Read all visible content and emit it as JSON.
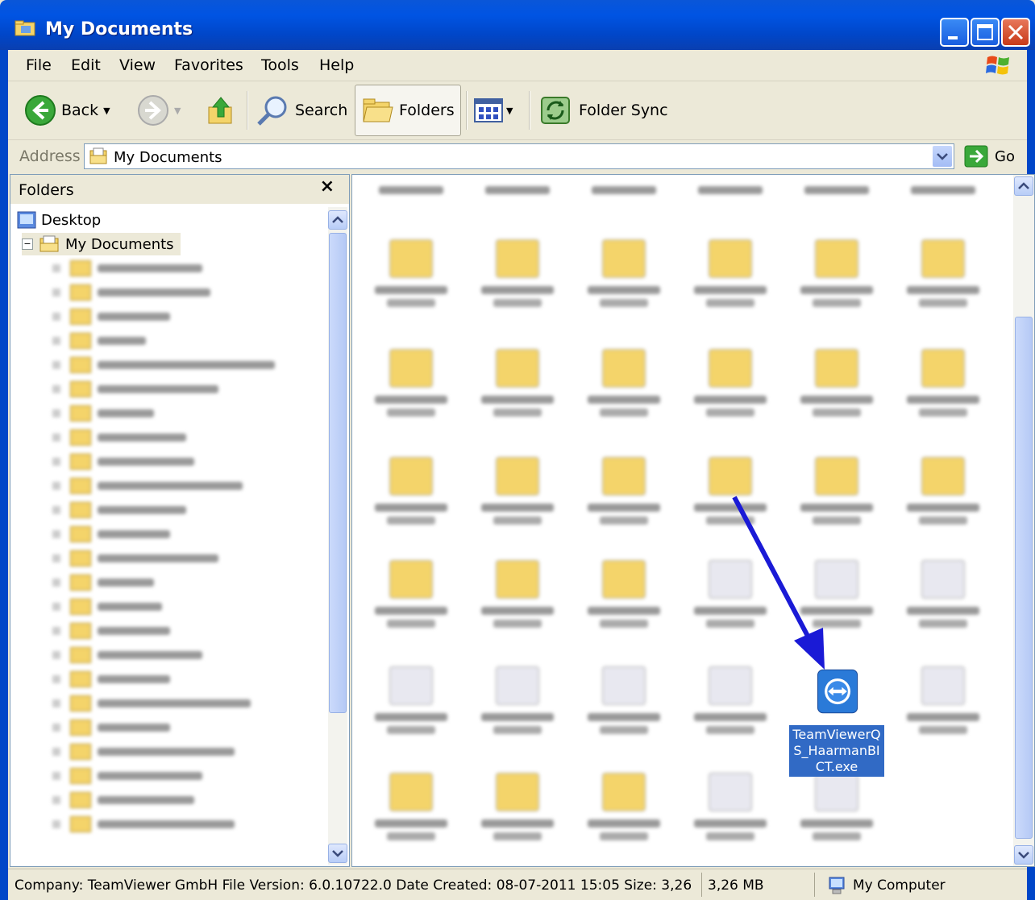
{
  "window": {
    "title": "My Documents"
  },
  "menu": [
    "File",
    "Edit",
    "View",
    "Favorites",
    "Tools",
    "Help"
  ],
  "toolbar": {
    "back": "Back",
    "search": "Search",
    "folders": "Folders",
    "folder_sync": "Folder Sync"
  },
  "address": {
    "label": "Address",
    "value": "My Documents",
    "go": "Go"
  },
  "folders_pane": {
    "title": "Folders",
    "close": "×",
    "desktop": "Desktop",
    "my_documents": "My Documents"
  },
  "selected_file": {
    "name_line1": "TeamViewerQ",
    "name_line2": "S_HaarmanBI",
    "name_line3": "CT.exe"
  },
  "status": {
    "details": "Company: TeamViewer GmbH File Version: 6.0.10722.0 Date Created: 08-07-2011 15:05 Size: 3,26",
    "size": "3,26 MB",
    "zone": "My Computer"
  },
  "colors": {
    "titlebar": "#0054e3",
    "selection": "#316ac5",
    "arrow": "#1a1ad6"
  }
}
